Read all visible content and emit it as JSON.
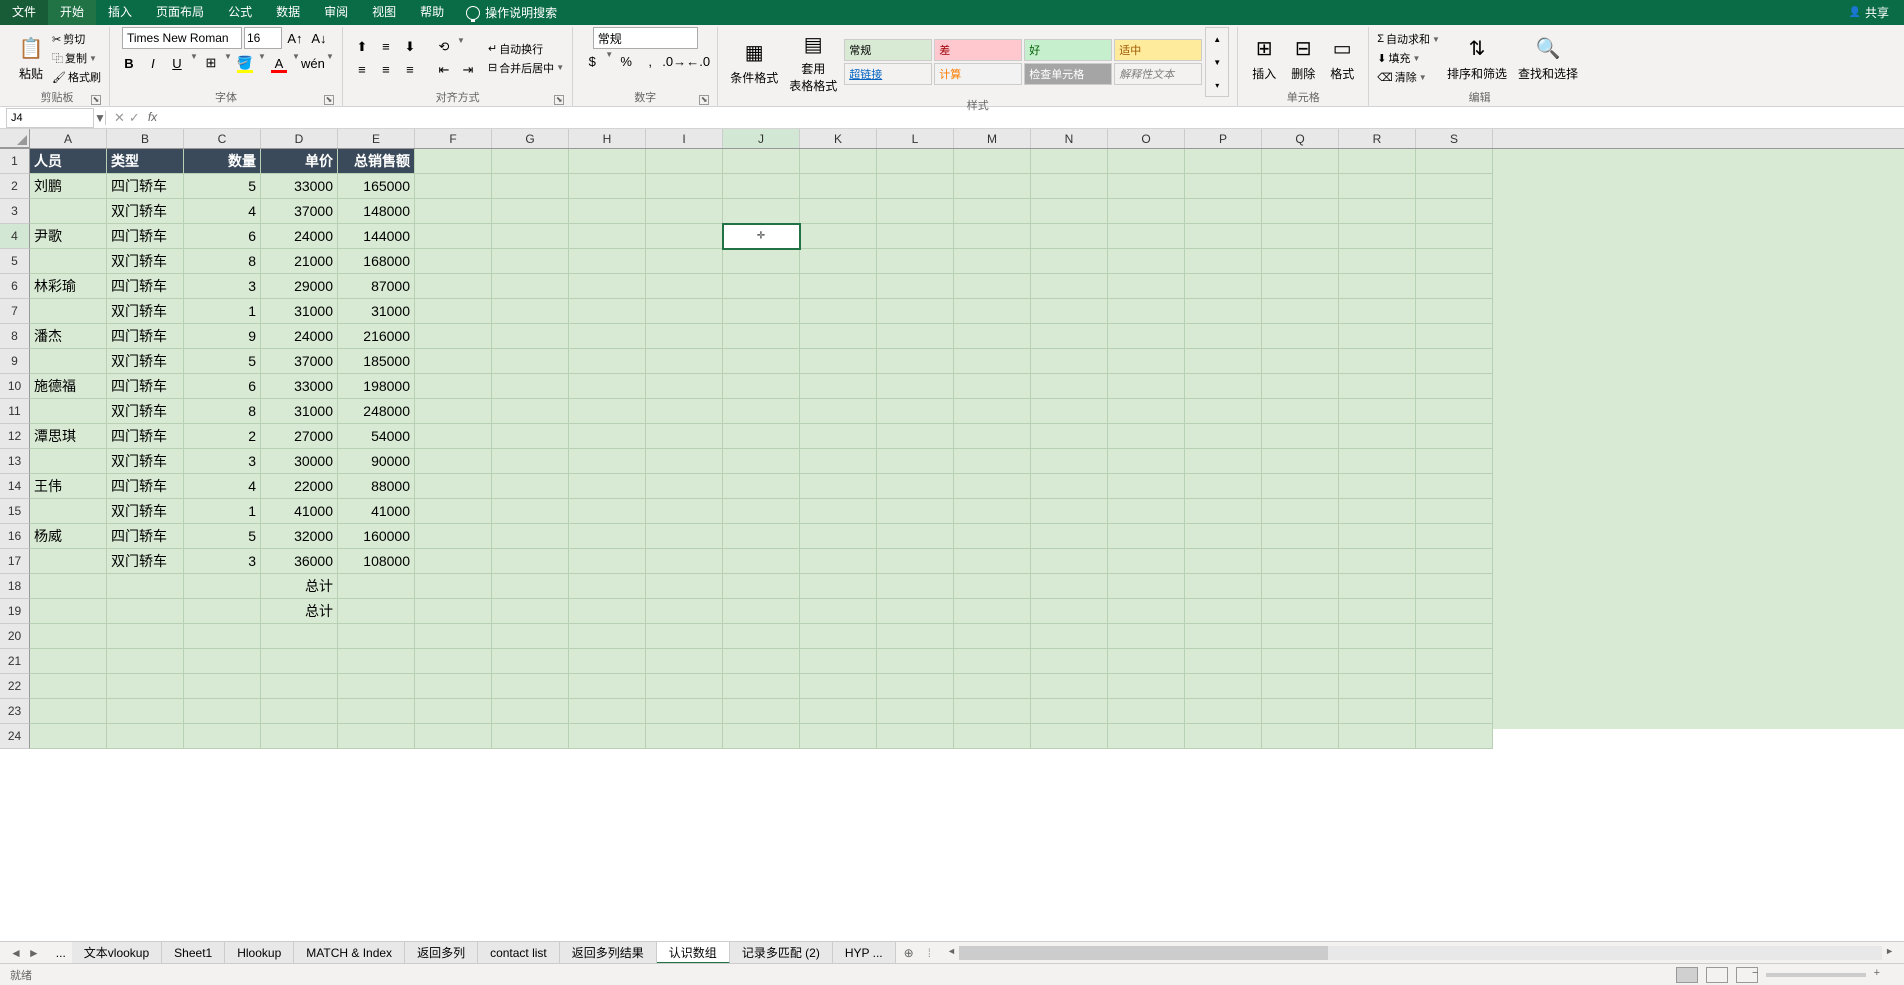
{
  "tabs": {
    "file": "文件",
    "home": "开始",
    "insert": "插入",
    "layout": "页面布局",
    "formula": "公式",
    "data": "数据",
    "review": "审阅",
    "view": "视图",
    "help": "帮助",
    "tell": "操作说明搜索"
  },
  "share": "共享",
  "clipboard": {
    "label": "剪贴板",
    "paste": "粘贴",
    "cut": "剪切",
    "copy": "复制",
    "painter": "格式刷"
  },
  "font": {
    "label": "字体",
    "name": "Times New Roman",
    "size": "16"
  },
  "align": {
    "label": "对齐方式",
    "wrap": "自动换行",
    "merge": "合并后居中"
  },
  "number": {
    "label": "数字",
    "format": "常规"
  },
  "styles": {
    "label": "样式",
    "cond": "条件格式",
    "table": "套用\n表格格式",
    "normal": "常规",
    "bad": "差",
    "good": "好",
    "neutral": "适中",
    "link": "超链接",
    "calc": "计算",
    "check": "检查单元格",
    "explain": "解释性文本"
  },
  "cells": {
    "label": "单元格",
    "insert": "插入",
    "delete": "删除",
    "format": "格式"
  },
  "editing": {
    "label": "编辑",
    "sum": "自动求和",
    "fill": "填充",
    "clear": "清除",
    "sort": "排序和筛选",
    "find": "查找和选择"
  },
  "namebox": "J4",
  "formula": "",
  "columns": [
    "A",
    "B",
    "C",
    "D",
    "E",
    "F",
    "G",
    "H",
    "I",
    "J",
    "K",
    "L",
    "M",
    "N",
    "O",
    "P",
    "Q",
    "R",
    "S"
  ],
  "headers": {
    "a": "人员",
    "b": "类型",
    "c": "数量",
    "d": "单价",
    "e": "总销售额"
  },
  "data_rows": [
    {
      "a": "刘鹏",
      "b": "四门轿车",
      "c": "5",
      "d": "33000",
      "e": "165000"
    },
    {
      "a": "",
      "b": "双门轿车",
      "c": "4",
      "d": "37000",
      "e": "148000"
    },
    {
      "a": "尹歌",
      "b": "四门轿车",
      "c": "6",
      "d": "24000",
      "e": "144000"
    },
    {
      "a": "",
      "b": "双门轿车",
      "c": "8",
      "d": "21000",
      "e": "168000"
    },
    {
      "a": "林彩瑜",
      "b": "四门轿车",
      "c": "3",
      "d": "29000",
      "e": "87000"
    },
    {
      "a": "",
      "b": "双门轿车",
      "c": "1",
      "d": "31000",
      "e": "31000"
    },
    {
      "a": "潘杰",
      "b": "四门轿车",
      "c": "9",
      "d": "24000",
      "e": "216000"
    },
    {
      "a": "",
      "b": "双门轿车",
      "c": "5",
      "d": "37000",
      "e": "185000"
    },
    {
      "a": "施德福",
      "b": "四门轿车",
      "c": "6",
      "d": "33000",
      "e": "198000"
    },
    {
      "a": "",
      "b": "双门轿车",
      "c": "8",
      "d": "31000",
      "e": "248000"
    },
    {
      "a": "潭思琪",
      "b": "四门轿车",
      "c": "2",
      "d": "27000",
      "e": "54000"
    },
    {
      "a": "",
      "b": "双门轿车",
      "c": "3",
      "d": "30000",
      "e": "90000"
    },
    {
      "a": "王伟",
      "b": "四门轿车",
      "c": "4",
      "d": "22000",
      "e": "88000"
    },
    {
      "a": "",
      "b": "双门轿车",
      "c": "1",
      "d": "41000",
      "e": "41000"
    },
    {
      "a": "杨威",
      "b": "四门轿车",
      "c": "5",
      "d": "32000",
      "e": "160000"
    },
    {
      "a": "",
      "b": "双门轿车",
      "c": "3",
      "d": "36000",
      "e": "108000"
    }
  ],
  "totals": {
    "r18": "总计",
    "r19": "总计"
  },
  "sheets": [
    "文本vlookup",
    "Sheet1",
    "Hlookup",
    "MATCH & Index",
    "返回多列",
    "contact list",
    "返回多列结果",
    "认识数组",
    "记录多匹配 (2)",
    "HYP ..."
  ],
  "active_sheet": "认识数组",
  "status": "就绪",
  "selected_cell": "J4"
}
